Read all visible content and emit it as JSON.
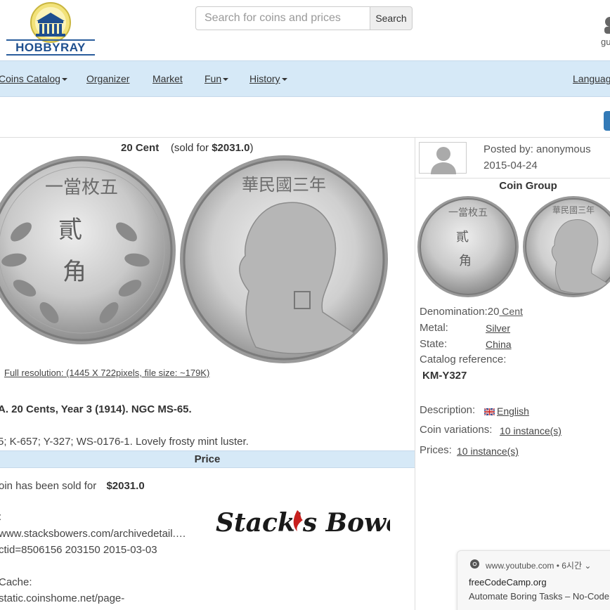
{
  "brand": {
    "logo_text": "HOBBYRAY"
  },
  "search": {
    "placeholder": "Search for coins and prices",
    "button_label": "Search"
  },
  "user": {
    "name": "gu"
  },
  "nav": {
    "items": [
      {
        "label": "Coins Catalog",
        "dropdown": true
      },
      {
        "label": "Organizer",
        "dropdown": false
      },
      {
        "label": "Market",
        "dropdown": false
      },
      {
        "label": "Fun",
        "dropdown": true
      },
      {
        "label": "History",
        "dropdown": true
      }
    ],
    "language": "Languag"
  },
  "coin": {
    "name": "20 Cent",
    "sold_prefix": "(sold for ",
    "sold_price": "$2031.0",
    "sold_suffix": ")",
    "full_resolution": "Full resolution: (1445 X 722pixels, file size: ~179K)",
    "description_title": "A. 20 Cents, Year 3 (1914). NGC MS-65.",
    "description_refs": "5; K-657; Y-327; WS-0176-1. Lovely frosty mint luster."
  },
  "price_section": {
    "header": "Price",
    "sold_text": "oin has been sold for",
    "sold_amount": "$2031.0",
    "source_label": ":",
    "source_url": "www.stacksbowers.com/archivedetail.…",
    "source_url2": "ctid=8506156 203150 2015-03-03",
    "cache_label": "Cache:",
    "cache_url": "static.coinshome.net/page-",
    "auction_logo": "Stack's Bowers"
  },
  "post": {
    "posted_by": "Posted by: anonymous",
    "date": "2015-04-24"
  },
  "coin_group": {
    "title": "Coin Group",
    "denomination_label": "Denomination:",
    "denomination_value": "20",
    "denomination_link": " Cent",
    "metal_label": "Metal:",
    "metal_value": "Silver",
    "state_label": "State:",
    "state_value": "China",
    "catalog_label": "Catalog reference:",
    "catalog_value": "KM-Y327",
    "description_label": "Description:",
    "description_value": "English",
    "variations_label": "Coin variations:",
    "variations_value": "10 instance(s)",
    "prices_label": "Prices:",
    "prices_value": "10 instance(s)"
  },
  "notification": {
    "source": "www.youtube.com  •  6시간 ⌄",
    "title": "freeCodeCamp.org",
    "body": "Automate Boring Tasks – No-Code"
  },
  "colors": {
    "nav_bg": "#d6e9f7",
    "brand_blue": "#1e4f8f",
    "accent_blue": "#337ab7"
  }
}
